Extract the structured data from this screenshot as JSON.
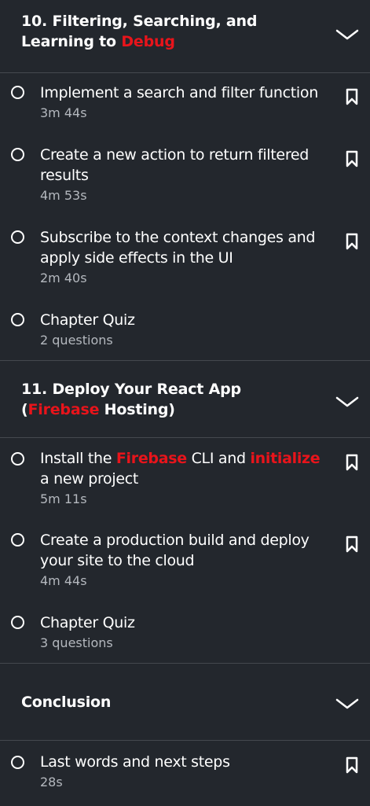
{
  "sections": [
    {
      "number": "10. ",
      "title_pre": "Filtering, Searching, and Learning to ",
      "title_hl": "Debug",
      "title_post": "",
      "items": [
        {
          "title": "Implement a search and filter function",
          "meta": "3m 44s",
          "bookmark": true
        },
        {
          "title": "Create a new action to return filtered results",
          "meta": "4m 53s",
          "bookmark": true
        },
        {
          "title": "Subscribe to the context changes and apply side effects in the UI",
          "meta": "2m 40s",
          "bookmark": true
        },
        {
          "title": "Chapter Quiz",
          "meta": "2 questions",
          "bookmark": false
        }
      ]
    },
    {
      "number": "11. ",
      "title_pre": "Deploy Your React App (",
      "title_hl": "Firebase",
      "title_post": " Hosting)",
      "items": [
        {
          "title_parts": [
            "Install the ",
            "Firebase",
            " CLI and ",
            "initialize",
            " a new project"
          ],
          "meta": "5m 11s",
          "bookmark": true
        },
        {
          "title": "Create a production build and deploy your site to the cloud",
          "meta": "4m 44s",
          "bookmark": true
        },
        {
          "title": "Chapter Quiz",
          "meta": "3 questions",
          "bookmark": false
        }
      ]
    },
    {
      "title": "Conclusion",
      "items": [
        {
          "title": "Last words and next steps",
          "meta": "28s",
          "bookmark": true
        }
      ]
    }
  ],
  "colors": {
    "background": "#23272d",
    "highlight": "#e8141b",
    "meta_text": "#b4b8be",
    "divider": "#44484e"
  },
  "icons": {
    "chevron": "chevron-down-icon",
    "bookmark": "bookmark-icon",
    "radio": "radio-circle-icon"
  }
}
